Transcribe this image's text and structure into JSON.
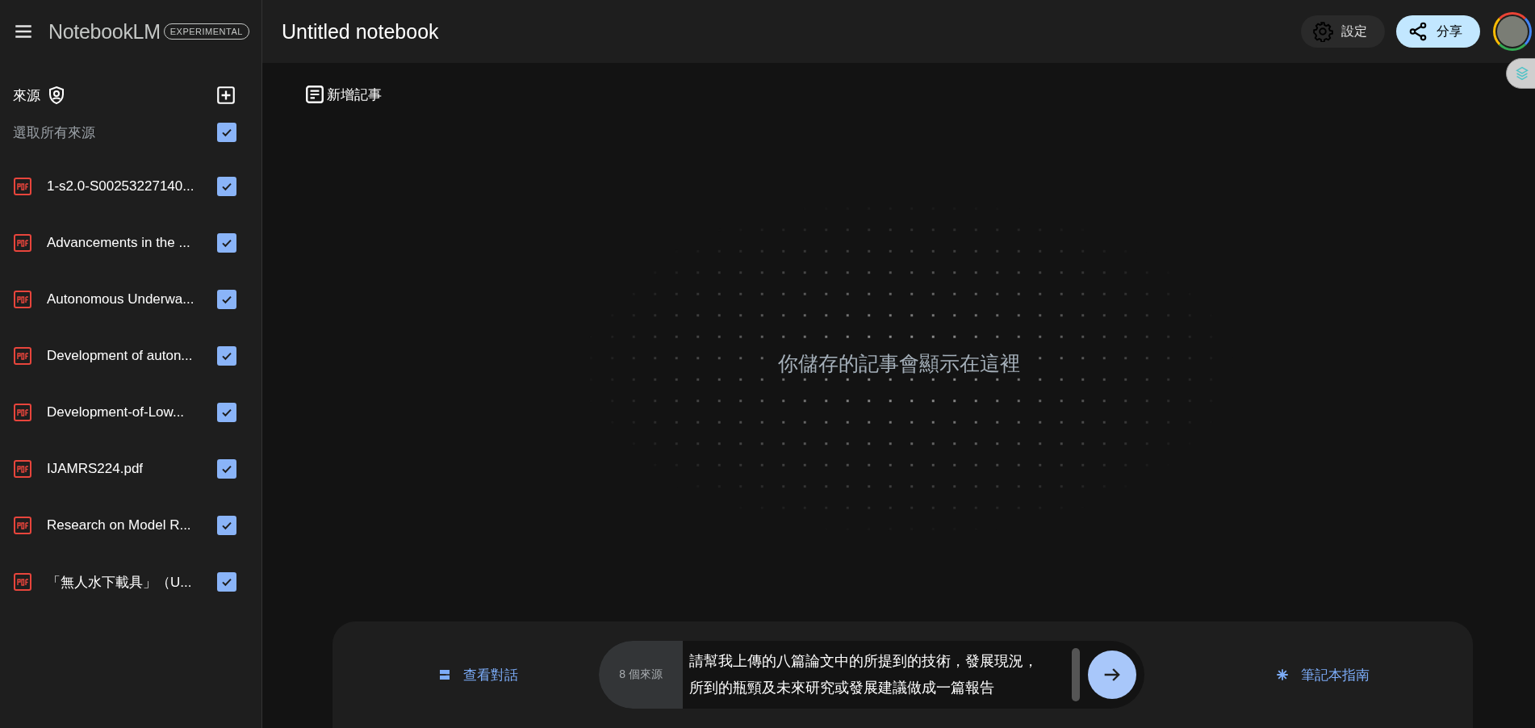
{
  "app": {
    "logo": "NotebookLM",
    "badge": "EXPERIMENTAL"
  },
  "sources": {
    "title": "來源",
    "select_all": {
      "label": "選取所有來源",
      "checked": true
    },
    "items": [
      {
        "name": "1-s2.0-S00253227140...",
        "checked": true
      },
      {
        "name": "Advancements in the ...",
        "checked": true
      },
      {
        "name": "Autonomous Underwa...",
        "checked": true
      },
      {
        "name": "Development of auton...",
        "checked": true
      },
      {
        "name": "Development-of-Low...",
        "checked": true
      },
      {
        "name": "IJAMRS224.pdf",
        "checked": true
      },
      {
        "name": "Research on Model R...",
        "checked": true
      },
      {
        "name": "「無人水下載具」（U...",
        "checked": true
      }
    ]
  },
  "header": {
    "title": "Untitled notebook",
    "settings": "設定",
    "share": "分享"
  },
  "notes": {
    "add_note": "新增記事",
    "empty_message": "你儲存的記事會顯示在這裡"
  },
  "chat": {
    "view_chat": "查看對話",
    "source_count": "8 個來源",
    "input_value": "請幫我上傳的八篇論文中的所提到的技術，發展現況，所到的瓶頸及未來研究或發展建議做成一篇報告",
    "notebook_guide": "筆記本指南"
  }
}
